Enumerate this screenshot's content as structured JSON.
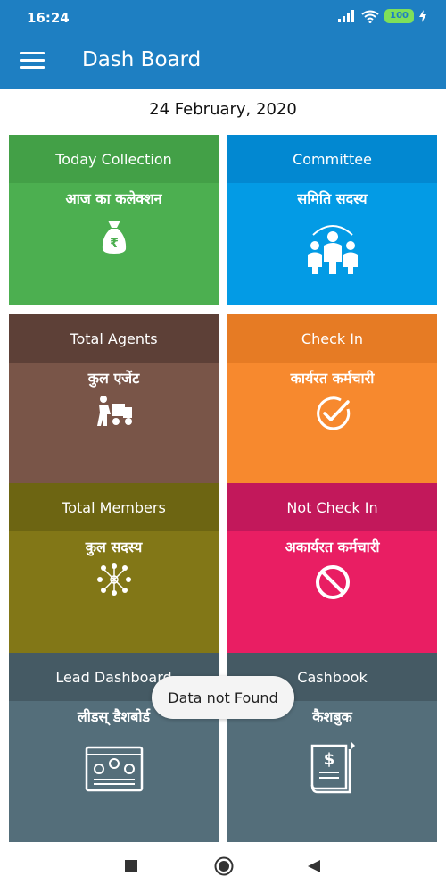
{
  "status_bar": {
    "time": "16:24",
    "battery": "100"
  },
  "app_bar": {
    "title": "Dash Board"
  },
  "date": "24 February, 2020",
  "colors": {
    "primary": "#1e7fc2",
    "today_head": "#43a047",
    "today_body": "#4caf50",
    "committee_head": "#0288d1",
    "committee_body": "#039be5",
    "agents_head": "#5d4037",
    "agents_body": "#795548",
    "checkin_head": "#e67b24",
    "checkin_body": "#f7892e",
    "members_head": "#6d6512",
    "members_body": "#827717",
    "notcheckin_head": "#c2185b",
    "notcheckin_body": "#e91e63",
    "lead_head": "#455a64",
    "lead_body": "#546e7a",
    "cashbook_head": "#455a64",
    "cashbook_body": "#546e7a"
  },
  "tiles": {
    "today_collection": {
      "title": "Today Collection",
      "subtitle": "आज का कलेक्शन",
      "icon": "money-bag-icon"
    },
    "committee": {
      "title": "Committee",
      "subtitle": "समिति सदस्य",
      "icon": "team-icon"
    },
    "total_agents": {
      "title": "Total Agents",
      "subtitle": "कुल एजेंट",
      "icon": "delivery-agent-icon"
    },
    "check_in": {
      "title": "Check In",
      "subtitle": "कार्यरत कर्मचारी",
      "icon": "check-circle-icon"
    },
    "total_members": {
      "title": "Total Members",
      "subtitle": "कुल सदस्य",
      "icon": "network-people-icon"
    },
    "not_check_in": {
      "title": "Not Check In",
      "subtitle": "अकार्यरत कर्मचारी",
      "icon": "prohibited-icon"
    },
    "lead_dashboard": {
      "title": "Lead Dashboard",
      "subtitle": "लीडस् डैशबोर्ड",
      "icon": "dashboard-screen-icon"
    },
    "cashbook": {
      "title": "Cashbook",
      "subtitle": "कैशबुक",
      "icon": "dollar-book-icon"
    }
  },
  "toast": {
    "message": "Data not Found"
  }
}
